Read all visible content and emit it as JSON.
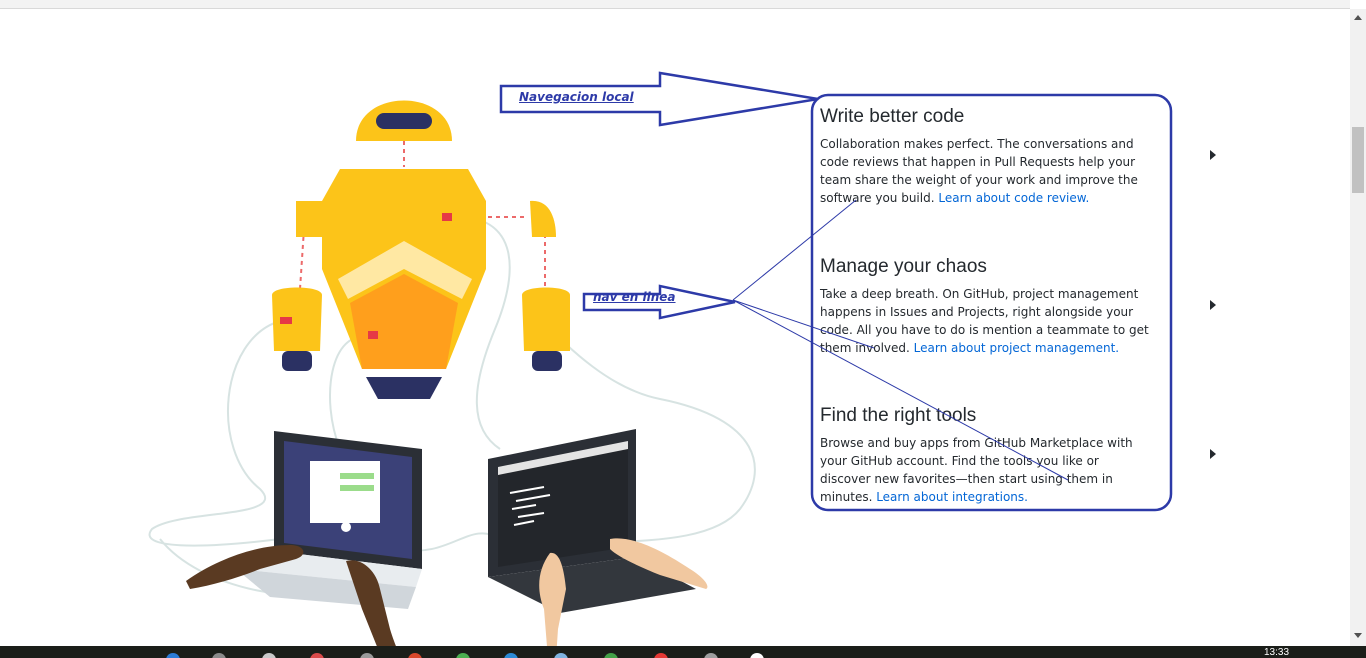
{
  "features": [
    {
      "title": "Write better code",
      "text": "Collaboration makes perfect. The conversations and code reviews that happen in Pull Requests help your team share the weight of your work and improve the software you build. ",
      "link": "Learn about code review."
    },
    {
      "title": "Manage your chaos",
      "text": "Take a deep breath. On GitHub, project management happens in Issues and Projects, right alongside your code. All you have to do is mention a teammate to get them involved. ",
      "link": "Learn about project management."
    },
    {
      "title": "Find the right tools",
      "text": "Browse and buy apps from GitHub Marketplace with your GitHub account. Find the tools you like or discover new favorites—then start using them in minutes. ",
      "link": "Learn about integrations."
    }
  ],
  "annotations": {
    "local_nav": "Navegacion local",
    "inline_nav": "nav en linea"
  },
  "taskbar": {
    "clock": "13:33"
  },
  "colors": {
    "annotation": "#2d3aa8",
    "link": "#0366d6",
    "robot_yellow": "#fcc419",
    "robot_orange": "#ff9f1c",
    "robot_navy": "#2b3163"
  }
}
